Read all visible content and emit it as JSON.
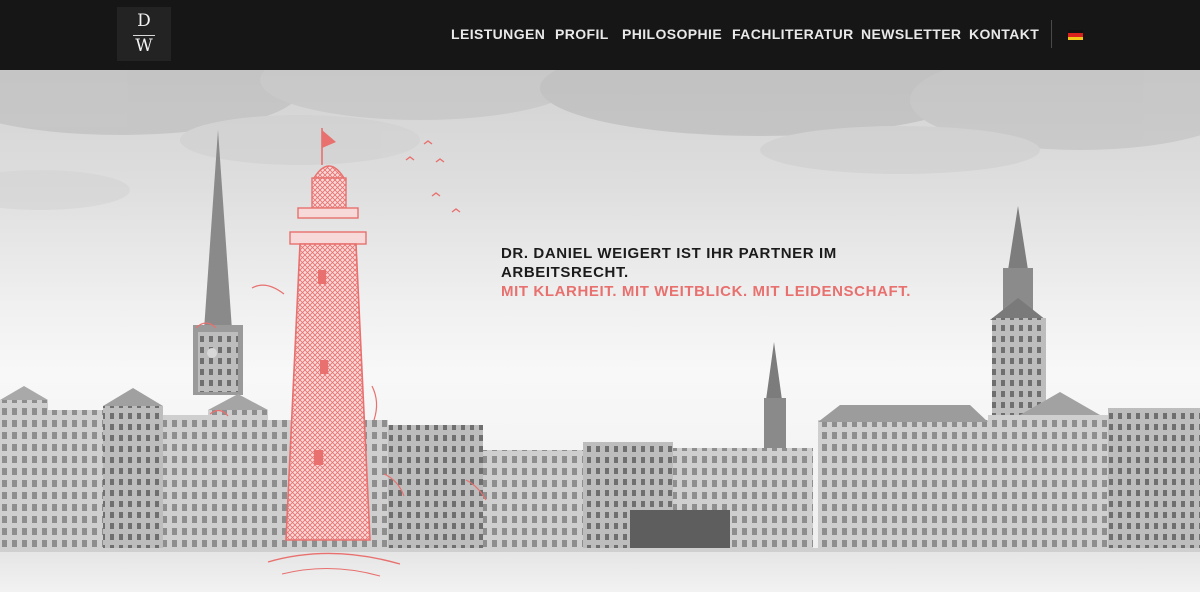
{
  "header": {
    "logo": {
      "top_letter": "D",
      "bottom_letter": "W"
    },
    "nav": [
      {
        "label": "LEISTUNGEN"
      },
      {
        "label": "PROFIL"
      },
      {
        "label": "PHILOSOPHIE"
      },
      {
        "label": "FACHLITERATUR"
      },
      {
        "label": "NEWSLETTER"
      },
      {
        "label": "KONTAKT"
      }
    ],
    "language_icon": "german-flag-icon"
  },
  "hero": {
    "headline": "DR. DANIEL WEIGERT IST IHR PARTNER IM ARBEITSRECHT.",
    "tagline": "MIT KLARHEIT. MIT WEITBLICK. MIT LEIDENSCHAFT.",
    "illustration_icon": "lighthouse-sketch-icon"
  },
  "colors": {
    "header_bg": "#161616",
    "nav_text": "#e9e9e9",
    "accent": "#e8706e",
    "headline_text": "#1b1b1b"
  }
}
